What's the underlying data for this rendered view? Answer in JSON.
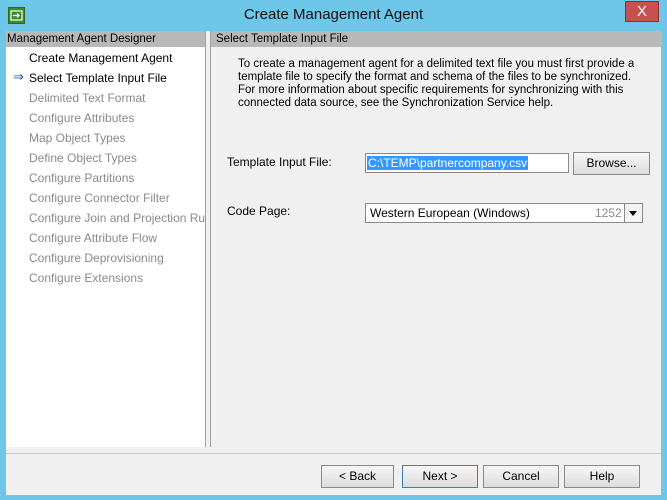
{
  "window": {
    "title": "Create Management Agent",
    "close_glyph": "X",
    "icon": "app-icon"
  },
  "sidebar": {
    "header": "Management Agent Designer",
    "items": [
      {
        "label": "Create Management Agent",
        "state": "done"
      },
      {
        "label": "Select Template Input File",
        "state": "current"
      },
      {
        "label": "Delimited Text Format",
        "state": "disabled"
      },
      {
        "label": "Configure Attributes",
        "state": "disabled"
      },
      {
        "label": "Map Object Types",
        "state": "disabled"
      },
      {
        "label": "Define Object Types",
        "state": "disabled"
      },
      {
        "label": "Configure Partitions",
        "state": "disabled"
      },
      {
        "label": "Configure Connector Filter",
        "state": "disabled"
      },
      {
        "label": "Configure Join and Projection Rules",
        "state": "disabled"
      },
      {
        "label": "Configure Attribute Flow",
        "state": "disabled"
      },
      {
        "label": "Configure Deprovisioning",
        "state": "disabled"
      },
      {
        "label": "Configure Extensions",
        "state": "disabled"
      }
    ],
    "current_arrow": "⇒"
  },
  "main": {
    "header": "Select Template Input File",
    "description": "To create a management agent for a delimited text file you must first provide a template file to specify the format and schema of the files to be synchronized. For more information about specific requirements for synchronizing with this connected data source, see the Synchronization Service help.",
    "template_label": "Template Input File:",
    "template_value": "C:\\TEMP\\partnercompany.csv",
    "browse_label": "Browse...",
    "code_page_label": "Code Page:",
    "code_page_value": "Western European (Windows)",
    "code_page_number": "1252"
  },
  "footer": {
    "back_label": "< Back",
    "next_label": "Next >",
    "cancel_label": "Cancel",
    "help_label": "Help"
  },
  "colors": {
    "titlebar": "#6ec6e8",
    "close": "#c75050",
    "selection": "#3399ff"
  }
}
